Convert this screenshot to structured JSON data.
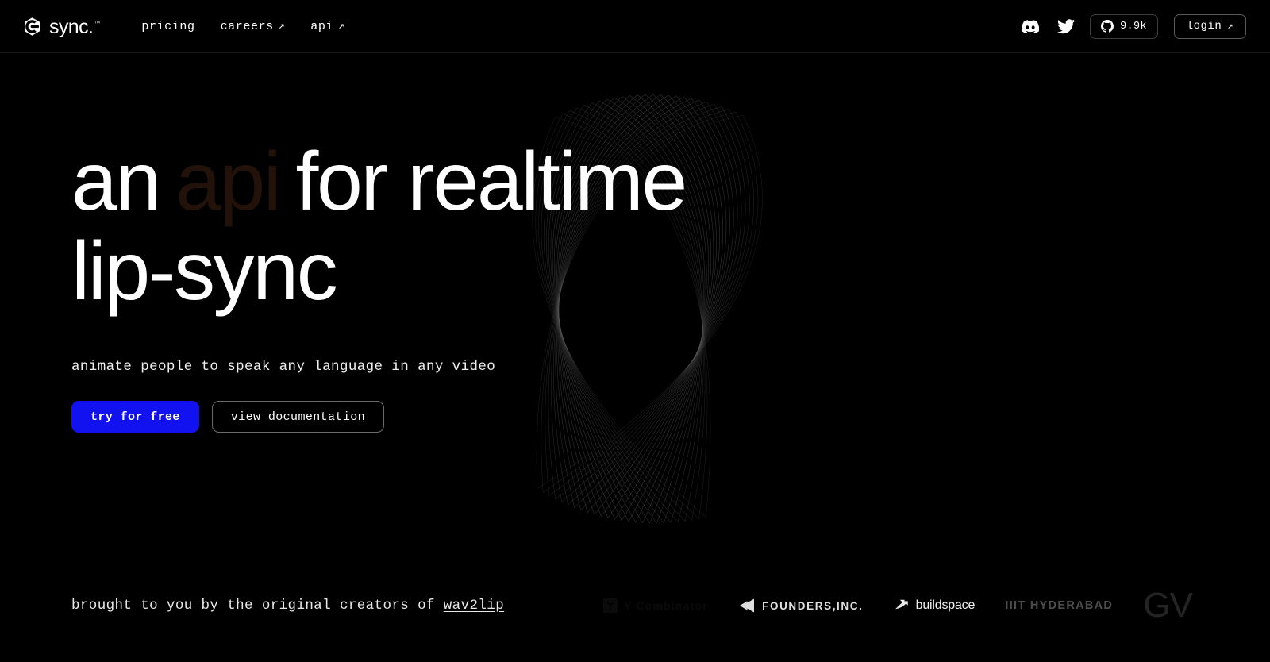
{
  "theme": {
    "background": "#000000",
    "text": "#ffffff",
    "accent_blue": "#1212f0",
    "accent_word_color": "#22120a",
    "border": "#3d3d3d",
    "wireframe_stroke": "#9a9a9a"
  },
  "navbar": {
    "brand": {
      "wordmark": "sync.",
      "trademark": "™",
      "logo_icon": "sync-hex-logo"
    },
    "links": [
      {
        "label": "pricing",
        "external": false,
        "arrow": ""
      },
      {
        "label": "careers",
        "external": true,
        "arrow": "↗"
      },
      {
        "label": "api",
        "external": true,
        "arrow": "↗"
      }
    ],
    "social": [
      {
        "name": "discord-icon",
        "label": "discord"
      },
      {
        "name": "twitter-icon",
        "label": "twitter"
      }
    ],
    "github": {
      "icon": "github-icon",
      "stars": "9.9k"
    },
    "login": {
      "label": "login",
      "arrow": "↗"
    }
  },
  "hero": {
    "headline": {
      "line1_part1": "an",
      "accent_word": "api",
      "line1_part2": "for realtime",
      "line2": "lip-sync"
    },
    "subtitle": "animate people to speak any language in any video",
    "cta_primary": "try for free",
    "cta_secondary": "view documentation"
  },
  "footer": {
    "credit_prefix": "brought to you by the original creators of ",
    "credit_link": "wav2lip",
    "partners": [
      {
        "name": "ycombinator",
        "label": "Y Combinator",
        "visible_text": "ator",
        "icon": "yc-square-icon",
        "opacity": "faded-out"
      },
      {
        "name": "founders-inc",
        "label": "FOUNDERS,INC.",
        "icon": "founders-chevron-icon"
      },
      {
        "name": "buildspace",
        "label": "buildspace",
        "icon": "buildspace-arrow-icon"
      },
      {
        "name": "iiit-hyderabad",
        "label": "IIIT HYDERABAD",
        "icon": ""
      },
      {
        "name": "google-ventures",
        "label": "GV",
        "icon": "gv-logo"
      }
    ]
  }
}
